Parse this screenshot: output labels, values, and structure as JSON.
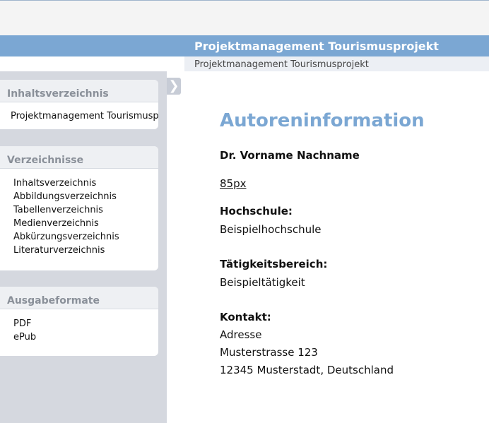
{
  "header": {
    "title": "Projektmanagement Tourismusprojekt"
  },
  "breadcrumb": {
    "text": "Projektmanagement Tourismusprojekt"
  },
  "sidebar": {
    "toggle_glyph": "❯",
    "toc": {
      "heading": "Inhaltsverzeichnis",
      "items": [
        "Projektmanagement Tourismusp"
      ]
    },
    "indexes": {
      "heading": "Verzeichnisse",
      "items": [
        "Inhaltsverzeichnis",
        "Abbildungsverzeichnis",
        "Tabellenverzeichnis",
        "Medienverzeichnis",
        "Abkürzungsverzeichnis",
        "Literaturverzeichnis"
      ]
    },
    "formats": {
      "heading": "Ausgabeformate",
      "items": [
        "PDF",
        "ePub"
      ]
    }
  },
  "main": {
    "heading": "Autoreninformation",
    "author": "Dr. Vorname Nachname",
    "image_link": "85px",
    "school_label": "Hochschule:",
    "school_value": "Beispielhochschule",
    "activity_label": "Tätigkeitsbereich:",
    "activity_value": "Beispieltätigkeit",
    "contact_label": "Kontakt:",
    "contact_lines": [
      "Adresse",
      "Musterstrasse 123",
      "12345 Musterstadt, Deutschland"
    ]
  },
  "colors": {
    "accent": "#7ba7d3",
    "sidebar_bg": "#d5d8df",
    "panel_head": "#eef0f3"
  }
}
